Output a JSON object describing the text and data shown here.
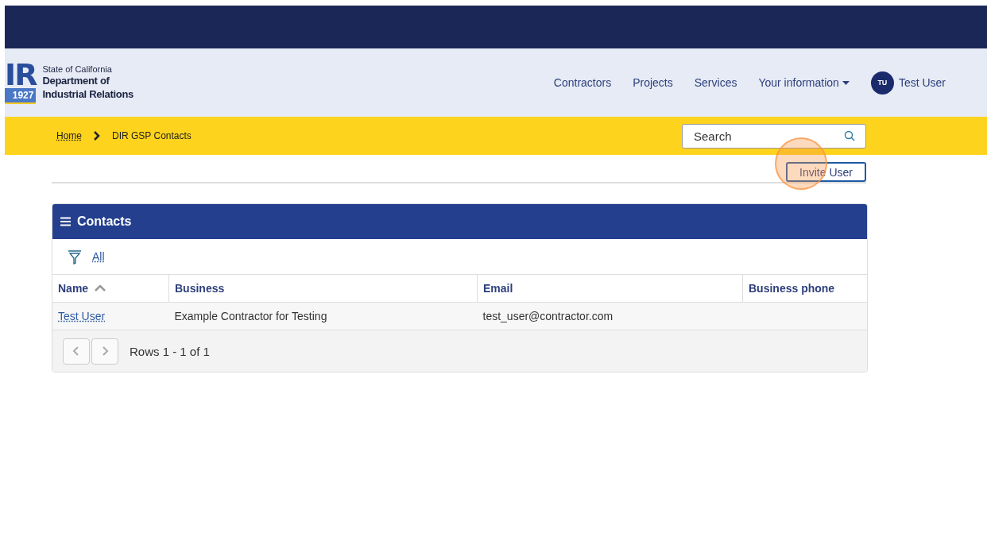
{
  "logo": {
    "letters": "IR",
    "year": "1927",
    "state": "State of California",
    "department": "Department of",
    "department_2": "Industrial Relations"
  },
  "nav": {
    "items": [
      {
        "label": "Contractors",
        "dropdown": false
      },
      {
        "label": "Projects",
        "dropdown": false
      },
      {
        "label": "Services",
        "dropdown": false
      },
      {
        "label": "Your information",
        "dropdown": true
      }
    ],
    "user": {
      "initials": "TU",
      "name": "Test User"
    }
  },
  "breadcrumb": [
    "Home",
    "DIR GSP Contacts"
  ],
  "search": {
    "placeholder": "Search"
  },
  "invite_button": "Invite User",
  "panel": {
    "title": "Contacts",
    "filter": "All",
    "columns": [
      {
        "label": "Name",
        "sorted": true
      },
      {
        "label": "Business",
        "sorted": false
      },
      {
        "label": "Email",
        "sorted": false
      },
      {
        "label": "Business phone",
        "sorted": false
      }
    ],
    "rows": [
      {
        "name": "Test User",
        "business": "Example Contractor for Testing",
        "email": "test_user@contractor.com"
      }
    ],
    "pager": "Rows 1 - 1 of 1"
  }
}
